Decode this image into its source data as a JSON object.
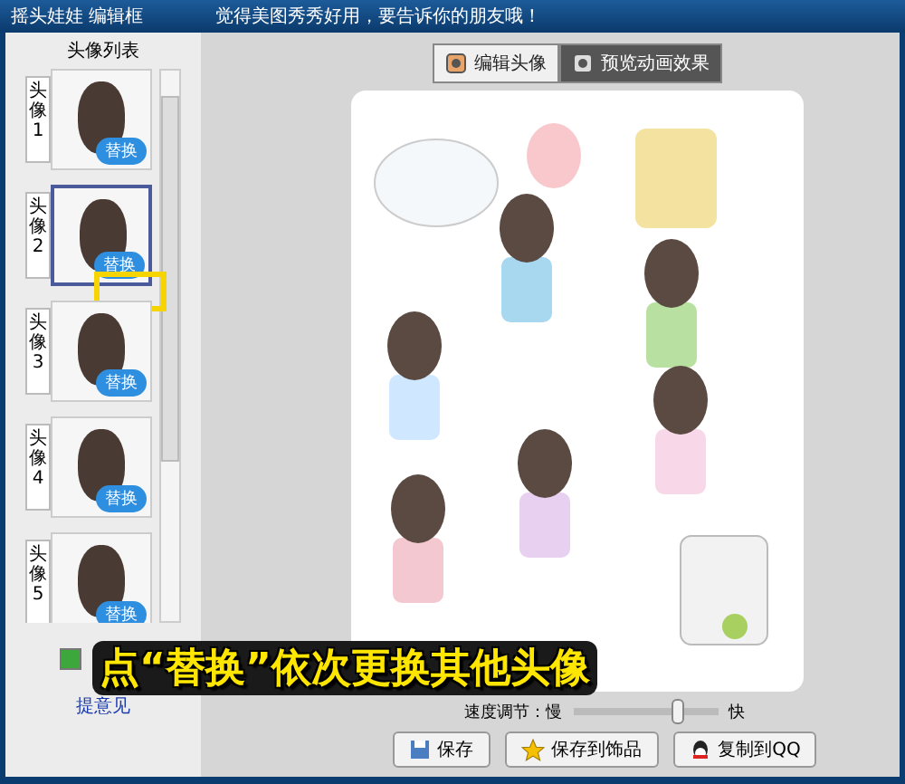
{
  "window": {
    "title": "摇头娃娃 编辑框",
    "banner": "觉得美图秀秀好用，要告诉你的朋友哦！"
  },
  "avatar_list": {
    "title": "头像列表",
    "items": [
      {
        "label": "头像",
        "number": "1",
        "button": "替换",
        "selected": false,
        "highlighted": false
      },
      {
        "label": "头像",
        "number": "2",
        "button": "替换",
        "selected": true,
        "highlighted": true
      },
      {
        "label": "头像",
        "number": "3",
        "button": "替换",
        "selected": false,
        "highlighted": false
      },
      {
        "label": "头像",
        "number": "4",
        "button": "替换",
        "selected": false,
        "highlighted": false
      },
      {
        "label": "头像",
        "number": "5",
        "button": "替换",
        "selected": false,
        "highlighted": false
      }
    ]
  },
  "feedback_checkbox": {
    "checked": true
  },
  "feedback_link": "提意见",
  "tabs": [
    {
      "label": "编辑头像",
      "selected": false
    },
    {
      "label": "预览动画效果",
      "selected": true
    }
  ],
  "speed": {
    "label": "速度调节：慢",
    "max_label": "快",
    "level": 0.72
  },
  "buttons": [
    {
      "label": "保存",
      "kind": "save"
    },
    {
      "label": "保存到饰品",
      "kind": "star"
    },
    {
      "label": "复制到QQ",
      "kind": "qq"
    }
  ],
  "annotation": "点“替换”依次更换其他头像"
}
